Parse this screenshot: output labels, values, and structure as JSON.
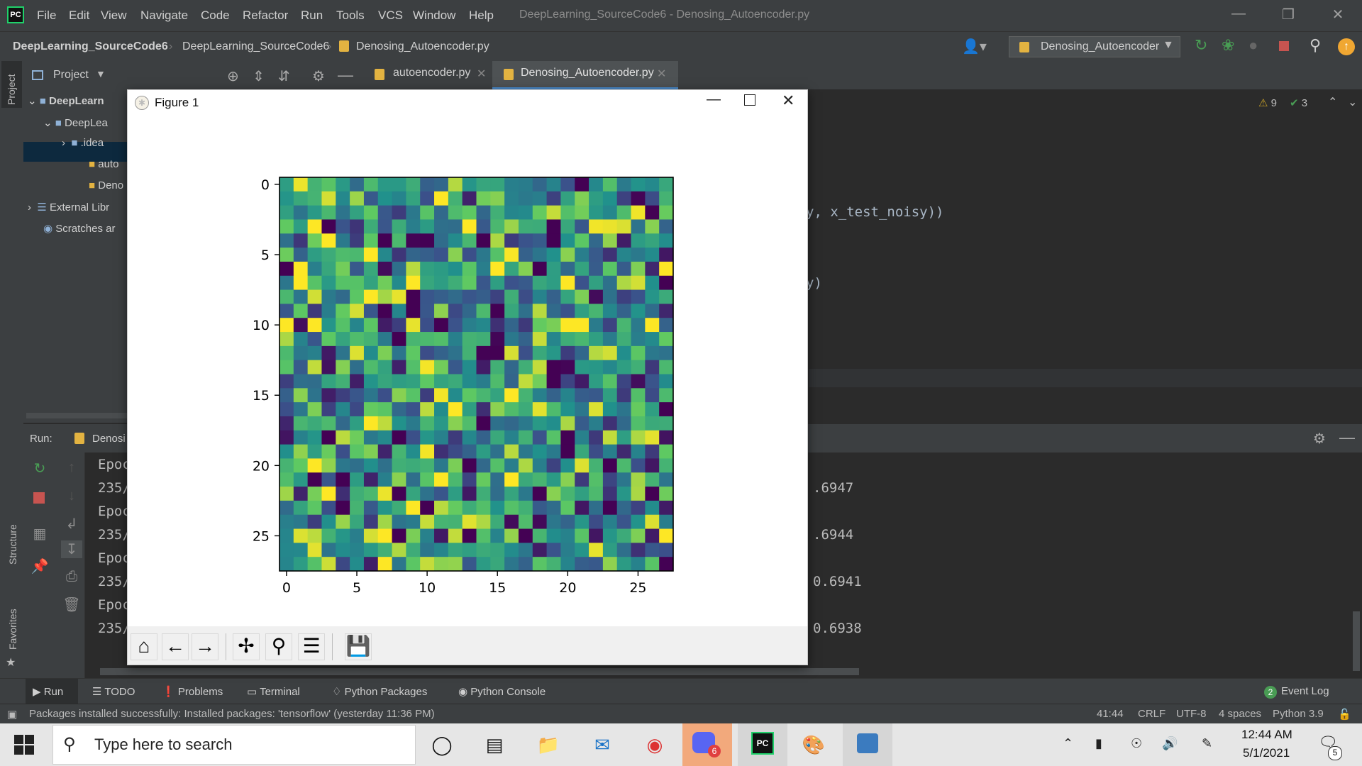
{
  "titlebar": {
    "menus": [
      "File",
      "Edit",
      "View",
      "Navigate",
      "Code",
      "Refactor",
      "Run",
      "Tools",
      "VCS",
      "Window",
      "Help"
    ],
    "window_title": "DeepLearning_SourceCode6 - Denosing_Autoencoder.py"
  },
  "navbar": {
    "breadcrumbs": [
      "DeepLearning_SourceCode6",
      "DeepLearning_SourceCode6",
      "Denosing_Autoencoder.py"
    ],
    "run_config": "Denosing_Autoencoder"
  },
  "project": {
    "label": "Project",
    "tree": [
      "DeepLearn",
      "DeepLea",
      ".idea",
      "auto",
      "Deno",
      "External Libr",
      "Scratches ar"
    ]
  },
  "tabs": [
    "autoencoder.py",
    "Denosing_Autoencoder.py"
  ],
  "editor": {
    "warnings": "9",
    "checks": "3",
    "code_lines": [
      "y, x_test_noisy))",
      "y)"
    ]
  },
  "run": {
    "label": "Run:",
    "config": "Denosi",
    "lines_left": [
      "Epoc",
      "235/",
      "Epoc",
      "235/",
      "Epoc",
      "235/",
      "Epoc",
      "235/"
    ],
    "lines_right": [
      ".6947",
      ".6944",
      "0.6941",
      "0.6938"
    ]
  },
  "tooltabs": [
    "Run",
    "TODO",
    "Problems",
    "Terminal",
    "Python Packages",
    "Python Console"
  ],
  "event_log": {
    "label": "Event Log",
    "count": "2"
  },
  "status": {
    "message": "Packages installed successfully: Installed packages: 'tensorflow' (yesterday 11:36 PM)",
    "position": "41:44",
    "line_sep": "CRLF",
    "encoding": "UTF-8",
    "indent": "4 spaces",
    "interpreter": "Python 3.9"
  },
  "figure": {
    "title": "Figure 1"
  },
  "chart_data": {
    "type": "heatmap",
    "title": "",
    "xlabel": "",
    "ylabel": "",
    "xlim": [
      -0.5,
      27.5
    ],
    "ylim": [
      27.5,
      -0.5
    ],
    "x_ticks": [
      "0",
      "5",
      "10",
      "15",
      "20",
      "25"
    ],
    "y_ticks": [
      "0",
      "5",
      "10",
      "15",
      "20",
      "25"
    ],
    "colormap": "viridis",
    "rows": 28,
    "cols": 28,
    "values": "random noise image (28x28 pixel intensities, viridis colormap)"
  },
  "taskbar": {
    "search_placeholder": "Type here to search",
    "time": "12:44 AM",
    "date": "5/1/2021",
    "notifications": "5",
    "discord_badge": "6"
  },
  "colors": {
    "ide_bg": "#2b2b2b",
    "ide_panel": "#3c3f41",
    "accent_green": "#499c54",
    "stop_red": "#c75450"
  }
}
